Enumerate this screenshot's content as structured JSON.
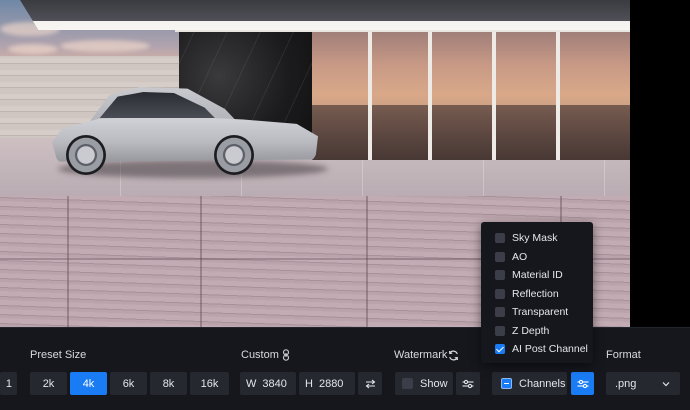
{
  "viewport": {
    "description": "3D render preview: modern glass house with silver SUV on travertine terrace at sunset"
  },
  "preset_size": {
    "label": "Preset Size",
    "partial_value": "1",
    "options": [
      "2k",
      "4k",
      "6k",
      "8k",
      "16k"
    ],
    "selected": "4k"
  },
  "custom": {
    "label": "Custom",
    "width_prefix": "W",
    "width": "3840",
    "height_prefix": "H",
    "height": "2880",
    "link_icon": "link-icon",
    "swap_icon": "swap-icon"
  },
  "watermark": {
    "label": "Watermark",
    "refresh_icon": "refresh-icon",
    "show_label": "Show",
    "show_checked": false,
    "settings_icon": "sliders-icon"
  },
  "channels": {
    "label": "Channels",
    "state": "partial",
    "settings_icon": "sliders-icon",
    "settings_active": true,
    "items": [
      {
        "label": "Sky Mask",
        "checked": false
      },
      {
        "label": "AO",
        "checked": false
      },
      {
        "label": "Material ID",
        "checked": false
      },
      {
        "label": "Reflection",
        "checked": false
      },
      {
        "label": "Transparent",
        "checked": false
      },
      {
        "label": "Z Depth",
        "checked": false
      },
      {
        "label": "AI Post Channel",
        "checked": true
      }
    ]
  },
  "format": {
    "label": "Format",
    "value": ".png",
    "chevron_icon": "chevron-down-icon"
  },
  "colors": {
    "toolbar_bg": "#16171d",
    "button_bg": "#262830",
    "accent": "#1a7cf5"
  }
}
